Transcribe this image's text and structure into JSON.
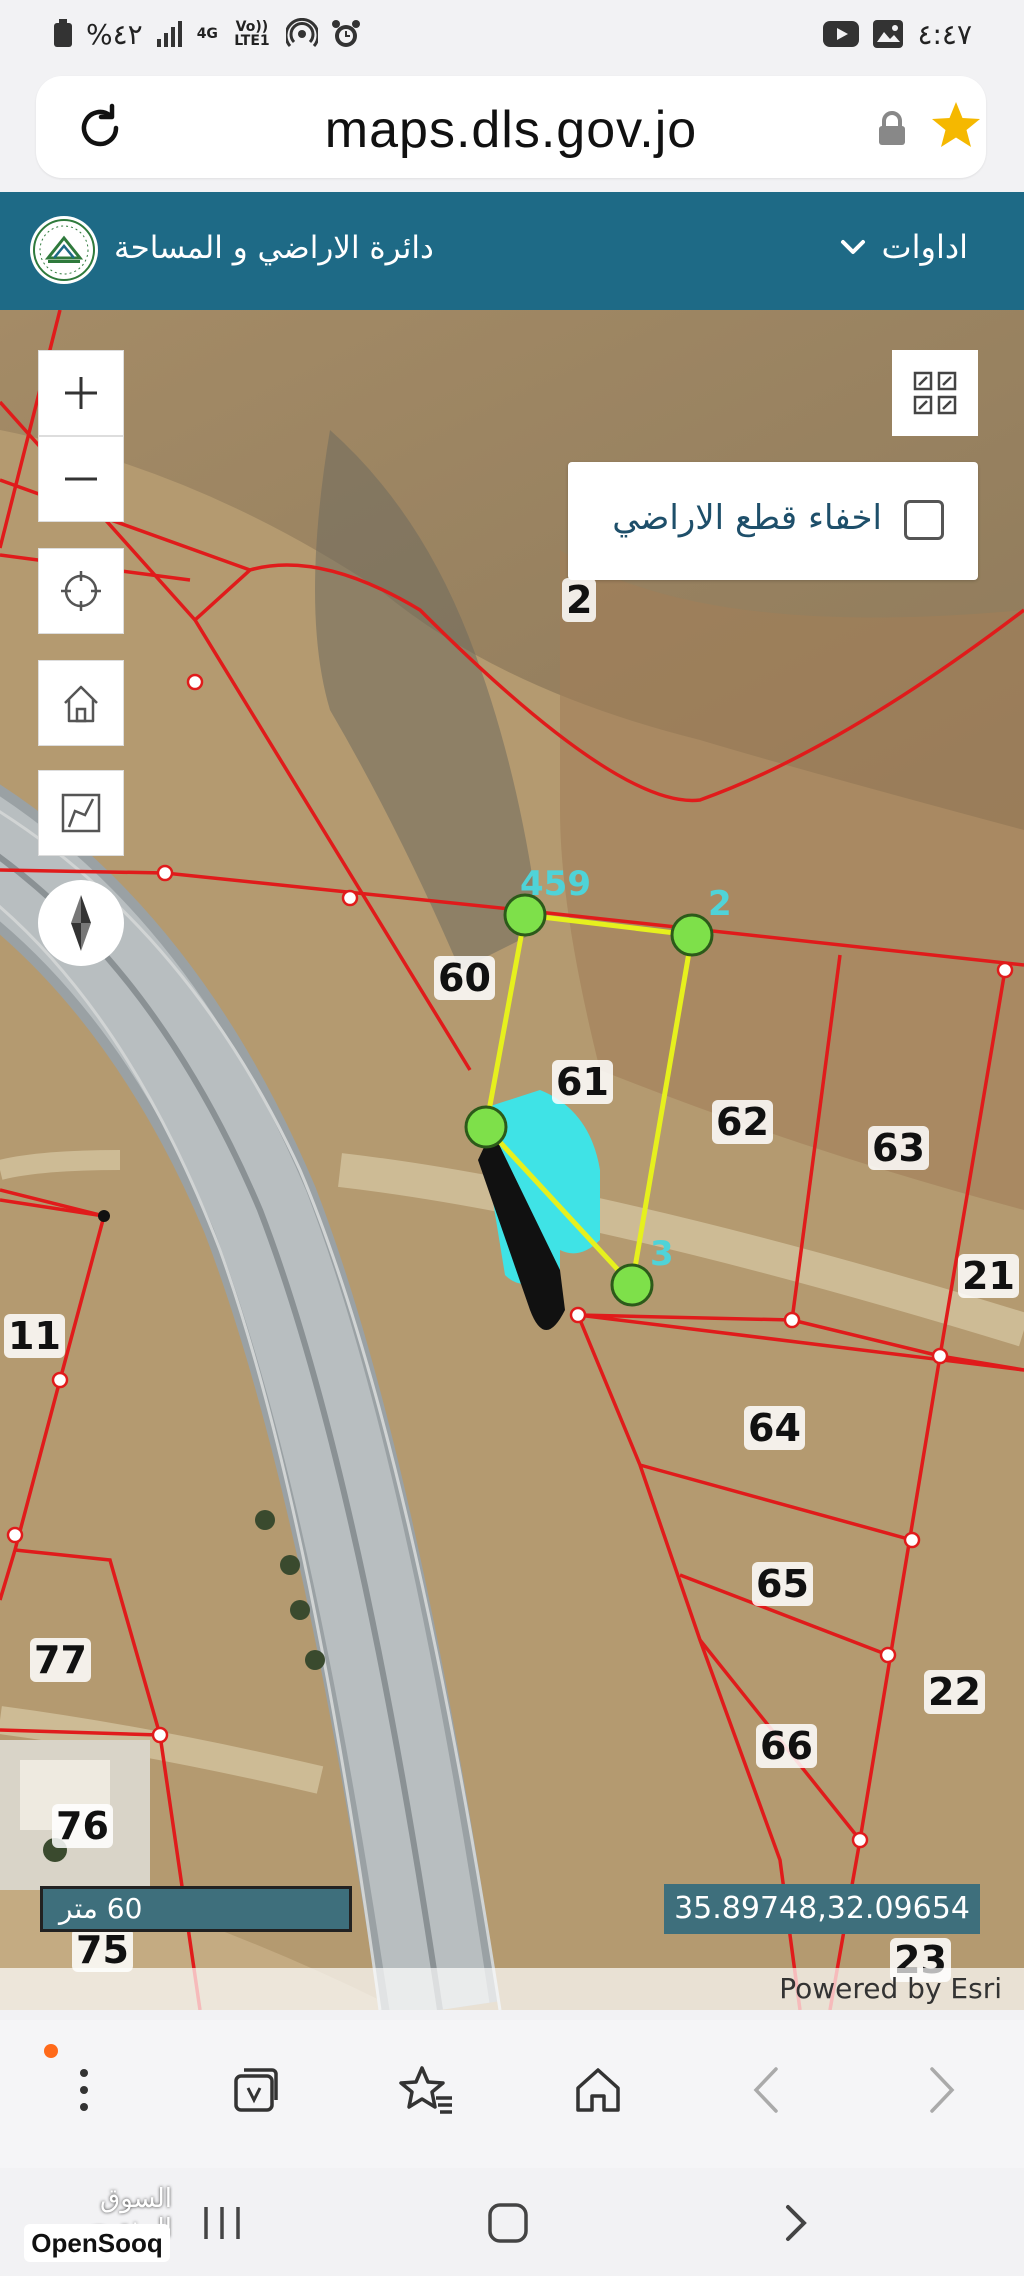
{
  "status_bar": {
    "battery": "%٤٢",
    "network": "4G",
    "volte": "Vo)) LTE1",
    "time": "٤:٤٧"
  },
  "browser": {
    "url": "maps.dls.gov.jo"
  },
  "app_header": {
    "org_name": "دائرة الاراضي و المساحة",
    "tools_label": "اداوات"
  },
  "map": {
    "hide_parcels_label": "اخفاء قطع الاراضي",
    "hide_parcels_checked": false,
    "parcels": [
      "2",
      "60",
      "61",
      "62",
      "63",
      "21",
      "11",
      "64",
      "65",
      "22",
      "66",
      "77",
      "76",
      "75",
      "23"
    ],
    "vertex_labels": [
      "459",
      "2",
      "3"
    ],
    "scale_label": "60 متر",
    "coordinates": "35.89748,32.09654",
    "attribution": "Powered by Esri"
  },
  "watermark": {
    "arabic": "السوق المفتوح",
    "english": "OpenSooq"
  },
  "colors": {
    "header_bg": "#1e6a86",
    "parcel_lines": "#e01b1b",
    "selection": "#e6f01e",
    "vertex": "#7ee04a",
    "star": "#f5b800"
  }
}
